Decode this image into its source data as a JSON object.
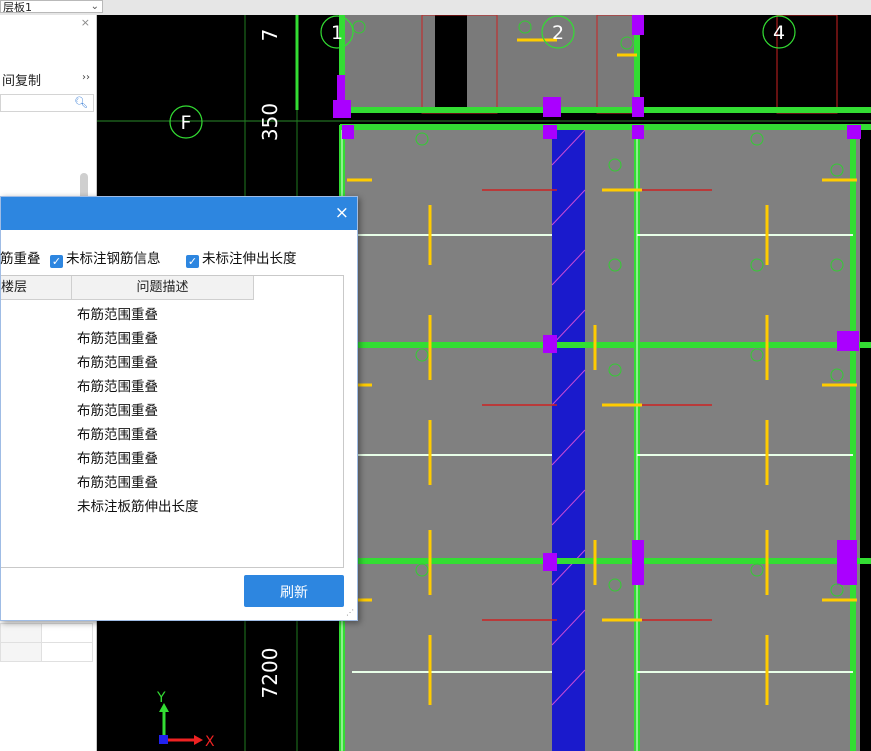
{
  "floor_selector": {
    "value": "层板1"
  },
  "left_panel": {
    "copy_label": "间复制",
    "more_glyph": "››",
    "close_glyph": "×"
  },
  "cad": {
    "axis_labels": [
      "1",
      "2",
      "4"
    ],
    "row_label": "F",
    "dimensions": [
      "7",
      "350",
      "7200"
    ],
    "ucs_y": "Y",
    "ucs_x": "X"
  },
  "dialog": {
    "close_glyph": "×",
    "checkboxes": [
      {
        "label": "筋重叠",
        "checked": true
      },
      {
        "label": "未标注钢筋信息",
        "checked": true
      },
      {
        "label": "未标注伸出长度",
        "checked": true
      }
    ],
    "columns": [
      "楼层",
      "问题描述"
    ],
    "rows": [
      "布筋范围重叠",
      "布筋范围重叠",
      "布筋范围重叠",
      "布筋范围重叠",
      "布筋范围重叠",
      "布筋范围重叠",
      "布筋范围重叠",
      "布筋范围重叠",
      "未标注板筋伸出长度"
    ],
    "refresh_label": "刷新"
  },
  "colors": {
    "dialog_accent": "#2d86e0",
    "slab_fill": "#808080",
    "beam_green": "#33dd33",
    "rebar_yellow": "#ffcc00",
    "column_magenta": "#aa00ff",
    "band_blue": "#1a1acc"
  }
}
